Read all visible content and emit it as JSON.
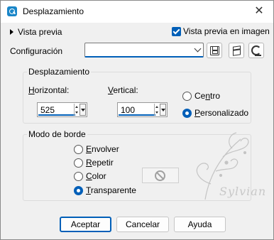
{
  "window": {
    "title": "Desplazamiento",
    "close_glyph": "✕"
  },
  "preview": {
    "toggle_label": "Vista previa",
    "checkbox_label": "Vista previa en imagen",
    "checkbox_checked": true
  },
  "config": {
    "label": "Configuración",
    "value": "",
    "icons": [
      "save-icon",
      "cube-icon",
      "reset-icon"
    ]
  },
  "displacement": {
    "legend": "Desplazamiento",
    "horizontal": {
      "label_u": "H",
      "label_rest": "orizontal:",
      "value": "525"
    },
    "vertical": {
      "label_u": "V",
      "label_rest": "ertical:",
      "value": "100"
    },
    "options": [
      {
        "u": "n",
        "pre": "Ce",
        "rest": "tro",
        "selected": false
      },
      {
        "u": "P",
        "pre": "",
        "rest": "ersonalizado",
        "selected": true
      }
    ]
  },
  "border_mode": {
    "legend": "Modo de borde",
    "options": [
      {
        "u": "E",
        "rest": "nvolver",
        "selected": false
      },
      {
        "u": "R",
        "rest": "epetir",
        "selected": false
      },
      {
        "u": "C",
        "rest": "olor",
        "selected": false
      },
      {
        "u": "T",
        "rest": "ransparente",
        "selected": true
      }
    ]
  },
  "watermark": {
    "text": "Sylvian"
  },
  "buttons": {
    "ok": "Aceptar",
    "cancel": "Cancelar",
    "help": "Ayuda"
  },
  "colors": {
    "accent": "#005fb8",
    "dialog_bg": "#f0f0f0"
  }
}
